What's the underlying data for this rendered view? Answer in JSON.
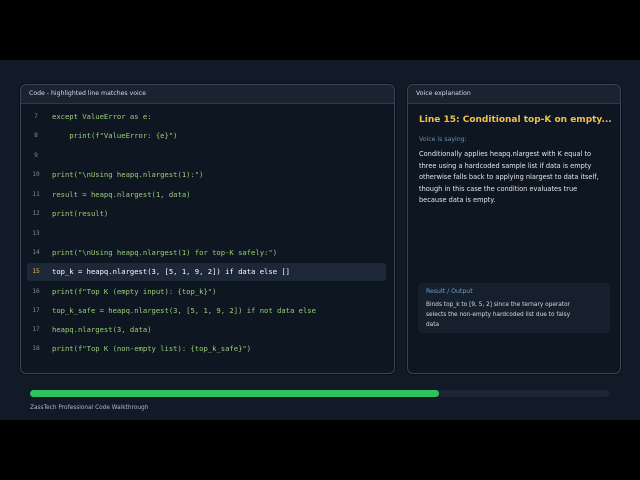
{
  "code_panel": {
    "header": "Code - highlighted line matches voice",
    "highlighted_line": "15",
    "lines": [
      {
        "num": "7",
        "text": "except ValueError as e:"
      },
      {
        "num": "8",
        "text": "    print(f\"ValueError: {e}\")"
      },
      {
        "num": "9",
        "text": ""
      },
      {
        "num": "10",
        "text": "print(\"\\nUsing heapq.nlargest(1):\")"
      },
      {
        "num": "11",
        "text": "result = heapq.nlargest(1, data)"
      },
      {
        "num": "12",
        "text": "print(result)"
      },
      {
        "num": "13",
        "text": ""
      },
      {
        "num": "14",
        "text": "print(\"\\nUsing heapq.nlargest(1) for top-K safely:\")"
      },
      {
        "num": "15",
        "text": "top_k = heapq.nlargest(3, [5, 1, 9, 2]) if data else []"
      },
      {
        "num": "16",
        "text": "print(f\"Top K (empty input): {top_k}\")"
      },
      {
        "num": "17",
        "text": "top_k_safe = heapq.nlargest(3, [5, 1, 9, 2]) if not data else"
      },
      {
        "num": "17",
        "text": "heapq.nlargest(3, data)"
      },
      {
        "num": "18",
        "text": "print(f\"Top K (non-empty list): {top_k_safe}\")"
      }
    ]
  },
  "voice_panel": {
    "header": "Voice explanation",
    "title": "Line 15: Conditional top-K on empty...",
    "saying_label": "Voice is saying:",
    "saying_text": "Conditionally applies heapq.nlargest with K equal to three using a hardcoded sample list if data is empty otherwise falls back to applying nlargest to data itself, though in this case the condition evaluates true because data is empty.",
    "result_label": "Result / Output",
    "result_text": "Binds top_k to [9, 5, 2] since the ternary operator selects the non-empty hardcoded list due to falsy data"
  },
  "progress": {
    "fraction": 0.705,
    "color": "#2fc15b"
  },
  "footer": "ZassTech Professional Code Walkthrough"
}
